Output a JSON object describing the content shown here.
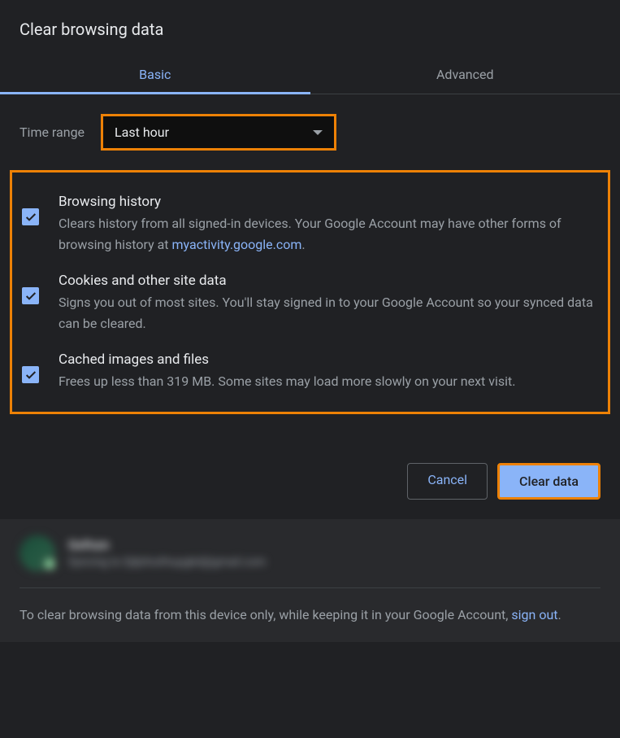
{
  "title": "Clear browsing data",
  "tabs": {
    "basic": "Basic",
    "advanced": "Advanced"
  },
  "timeRange": {
    "label": "Time range",
    "value": "Last hour"
  },
  "options": {
    "history": {
      "title": "Browsing history",
      "desc_before": "Clears history from all signed-in devices. Your Google Account may have other forms of browsing history at ",
      "link": "myactivity.google.com",
      "desc_after": "."
    },
    "cookies": {
      "title": "Cookies and other site data",
      "desc": "Signs you out of most sites. You'll stay signed in to your Google Account so your synced data can be cleared."
    },
    "cache": {
      "title": "Cached images and files",
      "desc": "Frees up less than 319 MB. Some sites may load more slowly on your next visit."
    }
  },
  "buttons": {
    "cancel": "Cancel",
    "clear": "Clear data"
  },
  "account": {
    "name": "Gxfnzn",
    "email": "Syncing to fjdjnhuhhupgkd@gmail.com"
  },
  "footer": {
    "text_before": "To clear browsing data from this device only, while keeping it in your Google Account, ",
    "link": "sign out",
    "text_after": "."
  }
}
